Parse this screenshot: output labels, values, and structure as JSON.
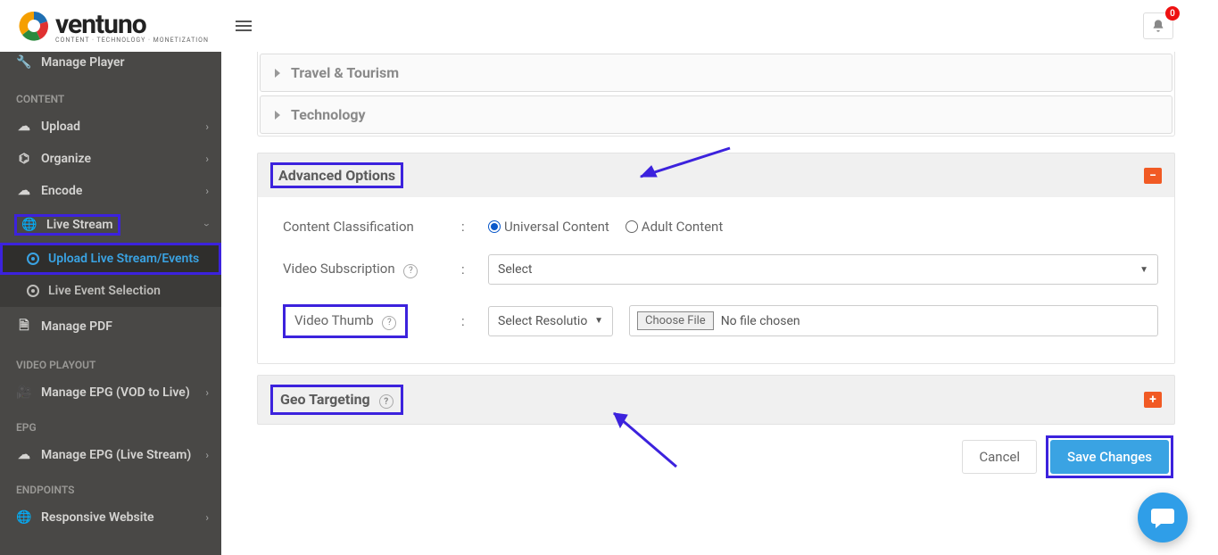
{
  "brand": {
    "name": "ventuno",
    "tagline": "CONTENT · TECHNOLOGY · MONETIZATION"
  },
  "notifications": {
    "count": "0"
  },
  "sidebar": {
    "manage_player": "Manage Player",
    "headers": {
      "content": "CONTENT",
      "video_playout": "VIDEO PLAYOUT",
      "epg": "EPG",
      "endpoints": "ENDPOINTS"
    },
    "items": {
      "upload": "Upload",
      "organize": "Organize",
      "encode": "Encode",
      "live_stream": "Live Stream",
      "upload_live": "Upload Live Stream/Events",
      "live_event_sel": "Live Event Selection",
      "manage_pdf": "Manage PDF",
      "manage_epg_vod": "Manage EPG (VOD to Live)",
      "manage_epg_live": "Manage EPG (Live Stream)",
      "responsive_site": "Responsive Website"
    }
  },
  "categories": {
    "travel": "Travel & Tourism",
    "technology": "Technology"
  },
  "advanced": {
    "title": "Advanced Options",
    "classification_label": "Content Classification",
    "universal": "Universal Content",
    "adult": "Adult Content",
    "subscription_label": "Video Subscription",
    "subscription_select": "Select",
    "thumb_label": "Video Thumb",
    "thumb_select": "Select Resolutio",
    "choose_file": "Choose File",
    "no_file": "No file chosen"
  },
  "geo": {
    "title": "Geo Targeting"
  },
  "actions": {
    "cancel": "Cancel",
    "save": "Save Changes"
  },
  "symbols": {
    "minus": "−",
    "plus": "+",
    "colon": ":"
  }
}
